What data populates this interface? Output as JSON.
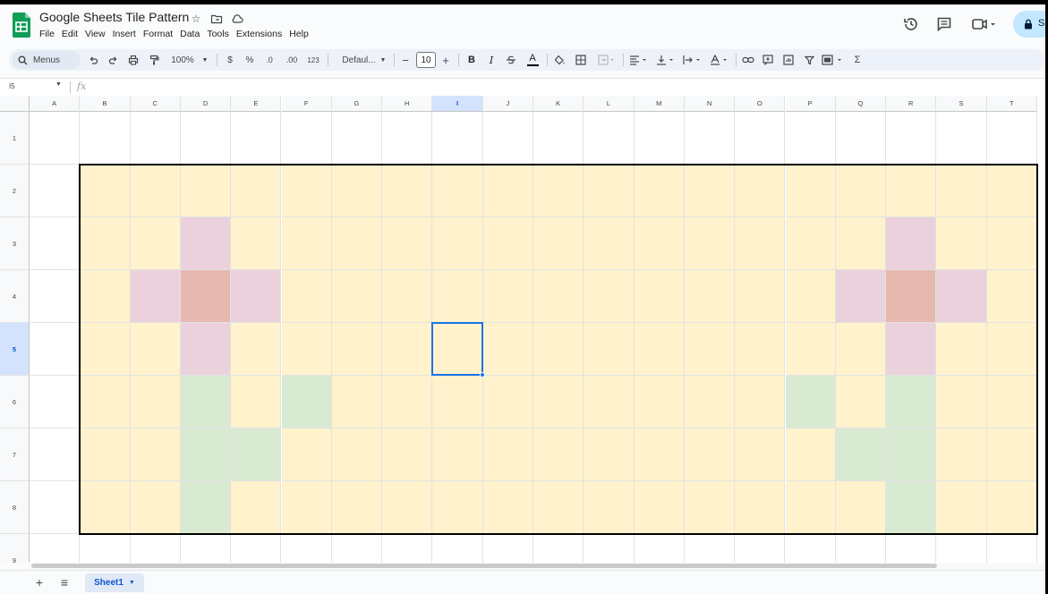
{
  "document": {
    "title": "Google Sheets Tile Pattern",
    "menu": [
      "File",
      "Edit",
      "View",
      "Insert",
      "Format",
      "Data",
      "Tools",
      "Extensions",
      "Help"
    ],
    "share_label": "S"
  },
  "toolbar": {
    "menus_label": "Menus",
    "zoom": "100%",
    "currency": "$",
    "percent": "%",
    "decrease_decimal": ".0",
    "increase_decimal": ".00",
    "number_format": "123",
    "font": "Defaul...",
    "font_size": "10",
    "minus": "−",
    "plus": "+",
    "bold": "B",
    "italic": "I",
    "text_color": "A",
    "sum": "Σ"
  },
  "formula_bar": {
    "cell_ref": "I5",
    "fx_label": "fx",
    "value": ""
  },
  "grid": {
    "columns": [
      "A",
      "B",
      "C",
      "D",
      "E",
      "F",
      "G",
      "H",
      "I",
      "J",
      "K",
      "L",
      "M",
      "N",
      "O",
      "P",
      "Q",
      "R",
      "S",
      "T"
    ],
    "rows": [
      "1",
      "2",
      "3",
      "4",
      "5",
      "6",
      "7",
      "8",
      "9"
    ],
    "selected_cell": {
      "col": "I",
      "row": "5"
    },
    "tile_range": {
      "from": "B2",
      "to": "T8"
    },
    "colors": {
      "background": "#fff2cc",
      "petal": "#ead1dc",
      "center": "#e6b8af",
      "stem": "#d9ead3",
      "selection": "#1a73e8"
    },
    "colored_cells": [
      {
        "cell": "D3",
        "fill": "petal"
      },
      {
        "cell": "C4",
        "fill": "petal"
      },
      {
        "cell": "D4",
        "fill": "center"
      },
      {
        "cell": "E4",
        "fill": "petal"
      },
      {
        "cell": "D5",
        "fill": "petal"
      },
      {
        "cell": "D6",
        "fill": "stem"
      },
      {
        "cell": "F6",
        "fill": "stem"
      },
      {
        "cell": "D7",
        "fill": "stem"
      },
      {
        "cell": "E7",
        "fill": "stem"
      },
      {
        "cell": "D8",
        "fill": "stem"
      },
      {
        "cell": "R3",
        "fill": "petal"
      },
      {
        "cell": "Q4",
        "fill": "petal"
      },
      {
        "cell": "R4",
        "fill": "center"
      },
      {
        "cell": "S4",
        "fill": "petal"
      },
      {
        "cell": "R5",
        "fill": "petal"
      },
      {
        "cell": "R6",
        "fill": "stem"
      },
      {
        "cell": "P6",
        "fill": "stem"
      },
      {
        "cell": "R7",
        "fill": "stem"
      },
      {
        "cell": "Q7",
        "fill": "stem"
      },
      {
        "cell": "R8",
        "fill": "stem"
      }
    ]
  },
  "sheets": {
    "add_label": "+",
    "list_label": "≡",
    "tabs": [
      {
        "name": "Sheet1",
        "active": true
      }
    ]
  }
}
